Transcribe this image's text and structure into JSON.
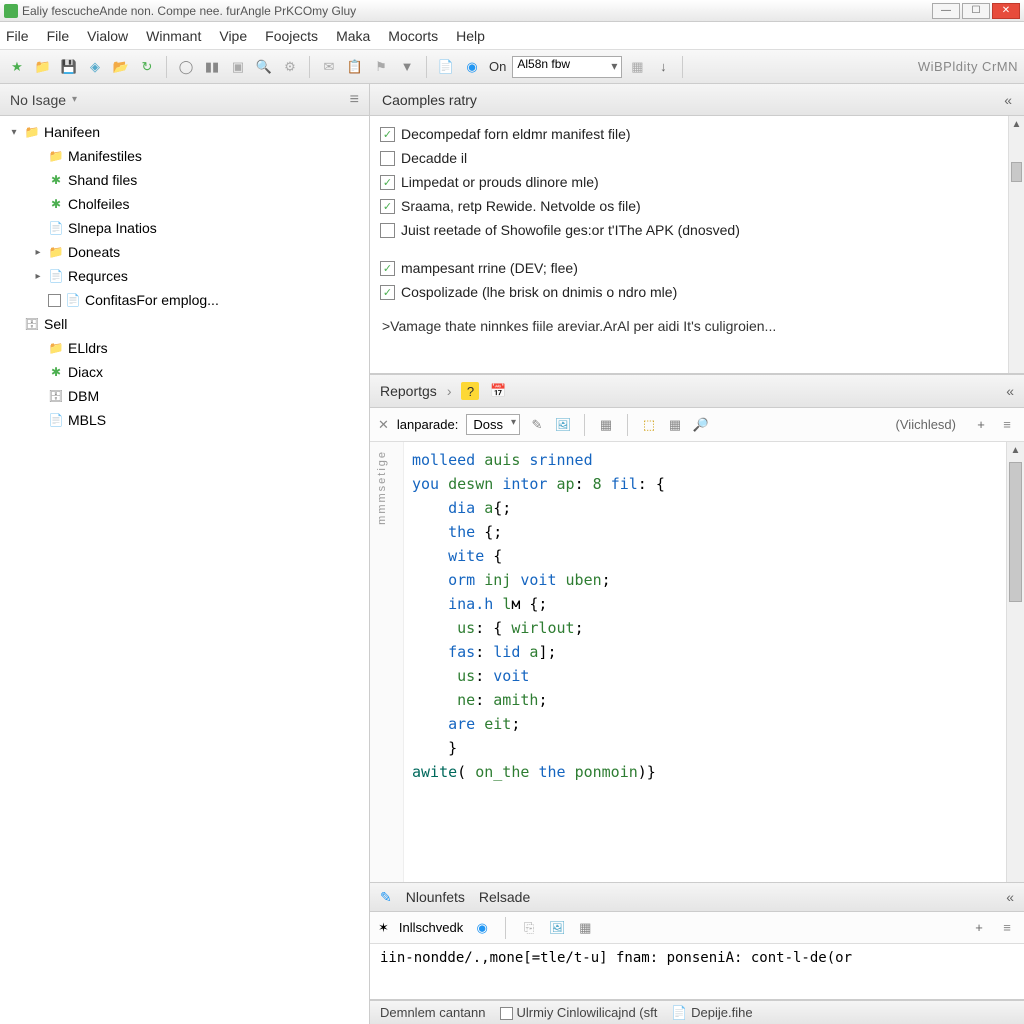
{
  "window_title": "Ealiy fescucheAnde non. Compe nee. furAngle PrKCOmy Gluy",
  "menubar": [
    "File",
    "File",
    "Vialow",
    "Winmant",
    "Vipe",
    "Foojects",
    "Maka",
    "Mocorts",
    "Help"
  ],
  "toolbar": {
    "on_label": "On",
    "select_value": "Al58n fbw",
    "right_label": "WiBPldity CrMN"
  },
  "left_panel": {
    "header": "No Isage",
    "tree": [
      {
        "label": "Hanifeen",
        "icon": "folder",
        "level": 0,
        "exp": "▾"
      },
      {
        "label": "Manifestiles",
        "icon": "folder",
        "level": 1
      },
      {
        "label": "Shand files",
        "icon": "gear",
        "level": 1
      },
      {
        "label": "Cholfeiles",
        "icon": "gear",
        "level": 1
      },
      {
        "label": "Slnepa Inatios",
        "icon": "file",
        "level": 1
      },
      {
        "label": "Doneats",
        "icon": "folder",
        "level": 1,
        "exp": "▸"
      },
      {
        "label": "Requrces",
        "icon": "file",
        "level": 1,
        "exp": "▸"
      },
      {
        "label": "ConfitasFor emplog...",
        "icon": "file",
        "level": 1,
        "chk": true
      },
      {
        "label": "Sell",
        "icon": "db",
        "level": 0
      },
      {
        "label": "ELldrs",
        "icon": "folder",
        "level": 1
      },
      {
        "label": "Diacx",
        "icon": "gear",
        "level": 1
      },
      {
        "label": "DBM",
        "icon": "db",
        "level": 1
      },
      {
        "label": "MBLS",
        "icon": "file",
        "level": 1
      }
    ]
  },
  "compile_panel": {
    "header": "Caomples ratry",
    "checks": [
      {
        "checked": true,
        "label": "Decompedaf forn eldmr manifest file)"
      },
      {
        "checked": false,
        "label": "Decadde il"
      },
      {
        "checked": true,
        "label": "Limpedat or prouds dlinore mle)"
      },
      {
        "checked": true,
        "label": "Sraama, retp Rewide. Netvolde os file)"
      },
      {
        "checked": false,
        "label": "Juist reetade of Showofile ges:or t'IThe APK (dnosved)"
      }
    ],
    "checks2": [
      {
        "checked": true,
        "label": "mampesant rrine (DEV; flee)"
      },
      {
        "checked": true,
        "label": "Cospolizade (lhe brisk on dnimis o ndro mle)"
      }
    ],
    "hint": ">Vamage thate ninnkes fiile areviar.ArAl per aidi It's culigroien..."
  },
  "reports": {
    "header": "Reportgs",
    "lang_label": "lanparade:",
    "lang_value": "Doss",
    "right_label": "(Viichlesd)"
  },
  "code_lines": [
    {
      "t": "<kw>molleed</kw> <id>auis</id> <kw>srinned</kw>"
    },
    {
      "t": "<kw>you</kw> <id>deswn</id> <kw>intor</kw> <id>ap</id>: <num>8</num> <kw>fil</kw>: {"
    },
    {
      "t": "    <kw>dia</kw> <id>a</id>{;"
    },
    {
      "t": "    <kw>the</kw> {;"
    },
    {
      "t": "    <kw>wite</kw> {"
    },
    {
      "t": "    <kw>orm</kw> <id>inj</id> <kw>voit</kw> <id>uben</id>;"
    },
    {
      "t": "    <kw>ina.h</kw> <id>l</id>м {;"
    },
    {
      "t": "     <id>us</id>: { <id>wirlout</id>;"
    },
    {
      "t": "    <kw>fas</kw>: <kw>lid</kw> <id>a</id>];"
    },
    {
      "t": "     <id>us</id>: <kw>voit</kw>"
    },
    {
      "t": "     <id>ne</id>: <id>amith</id>;"
    },
    {
      "t": "    <kw>are</kw> <id>eit</id>;"
    },
    {
      "t": "    }"
    },
    {
      "t": "<fn>awite</fn>( <id>on_the</id> <kw>the</kw> <id>ponmoin</id>)}"
    }
  ],
  "gutter_label": "mmmsetige",
  "bottom": {
    "tab1": "Nlounfets",
    "tab2": "Relsade",
    "label": "Inllschvedk"
  },
  "console_line": "iin-nondde/.,mone[=tle/t-u] fnam: ponseniA: cont-l-de(or",
  "statusbar": {
    "left": "Demnlem cantann",
    "chk_label": "Ulrmiy Cinlowilicajnd (sft",
    "right_label": "Depije.fihe"
  }
}
